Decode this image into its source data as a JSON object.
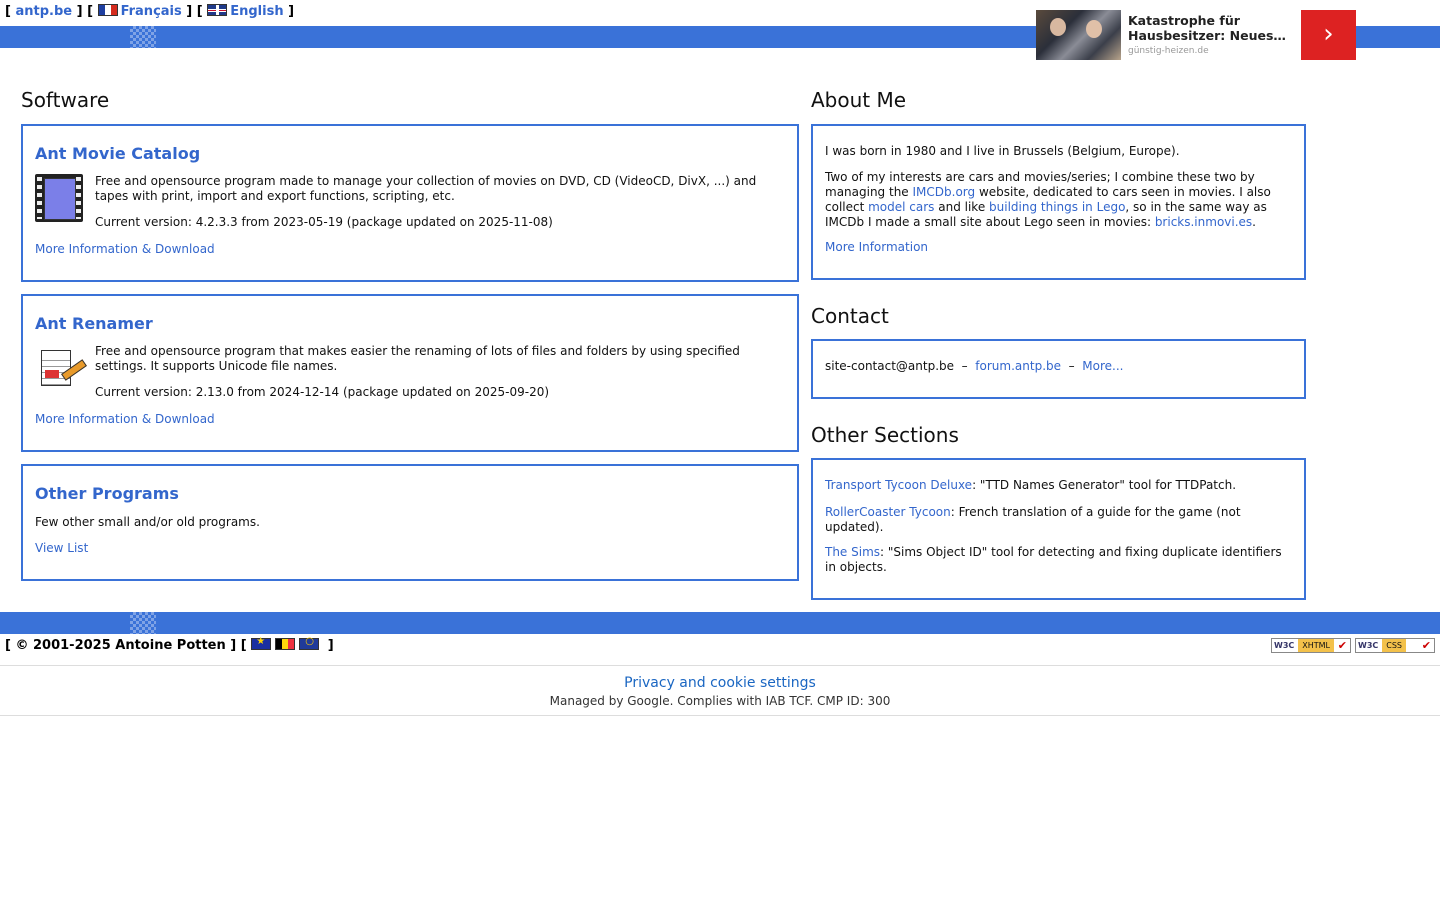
{
  "topnav": {
    "open": "[",
    "site": "antp.be",
    "sep1": "] [",
    "lang_fr": "Français",
    "sep2": "] [",
    "lang_en": "English",
    "close": "]"
  },
  "ad": {
    "title": "Katastrophe für Hausbesitzer: Neues…",
    "source": "günstig-heizen.de",
    "arrow": "›"
  },
  "software": {
    "heading": "Software",
    "amc": {
      "title": "Ant Movie Catalog",
      "description": "Free and opensource program made to manage your collection of movies on DVD, CD (VideoCD, DivX, ...) and tapes with print, import and export functions, scripting, etc.",
      "version": "Current version: 4.2.3.3 from 2023-05-19 (package updated on 2025-11-08)",
      "link": "More Information & Download",
      "icon": "film-icon"
    },
    "renamer": {
      "title": "Ant Renamer",
      "description": "Free and opensource program that makes easier the renaming of lots of files and folders by using specified settings. It supports Unicode file names.",
      "version": "Current version: 2.13.0 from 2024-12-14 (package updated on 2025-09-20)",
      "link": "More Information & Download",
      "icon": "rename-icon"
    },
    "other": {
      "title": "Other Programs",
      "description": "Few other small and/or old programs.",
      "link": "View List"
    }
  },
  "about": {
    "heading": "About Me",
    "p1": "I was born in 1980 and I live in Brussels (Belgium, Europe).",
    "p2_a": "Two of my interests are cars and movies/series; I combine these two by managing the ",
    "p2_link1": "IMCDb.org",
    "p2_b": " website, dedicated to cars seen in movies. I also collect ",
    "p2_link2": "model cars",
    "p2_c": " and like ",
    "p2_link3": "building things in Lego",
    "p2_d": ", so in the same way as IMCDb I made a small site about Lego seen in movies: ",
    "p2_link4": "bricks.inmovi.es",
    "p2_e": ".",
    "link": "More Information"
  },
  "contact": {
    "heading": "Contact",
    "email": "site-contact@antp.be",
    "dash1": "–",
    "forum": "forum.antp.be",
    "dash2": "–",
    "more": "More..."
  },
  "other_sections": {
    "heading": "Other Sections",
    "ttd_link": "Transport Tycoon Deluxe",
    "ttd_text": ": \"TTD Names Generator\" tool for TTDPatch.",
    "rct_link": "RollerCoaster Tycoon",
    "rct_text": ": French translation of a guide for the game (not updated).",
    "sims_link": "The Sims",
    "sims_text": ": \"Sims Object ID\" tool for detecting and fixing duplicate identifiers in objects."
  },
  "footer": {
    "copyright": "[ © 2001-2025 Antoine Potten ] [",
    "close": "]",
    "w3c_logo": "W3C",
    "xhtml": "XHTML",
    "css": "CSS",
    "check": "✔"
  },
  "consent": {
    "link": "Privacy and cookie settings",
    "managed": "Managed by Google. Complies with IAB TCF. CMP ID: 300"
  },
  "colors": {
    "accent": "#3a72d8",
    "link": "#3366cc",
    "ad_button": "#dd2222"
  }
}
